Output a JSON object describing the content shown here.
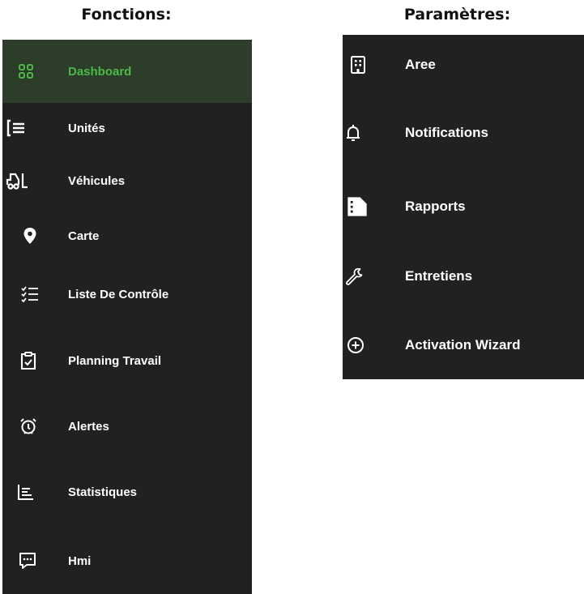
{
  "functions": {
    "heading": "Fonctions:",
    "items": [
      {
        "label": "Dashboard",
        "icon": "dashboard-grid-icon",
        "active": true
      },
      {
        "label": "Unités",
        "icon": "list-bracket-icon"
      },
      {
        "label": "Véhicules",
        "icon": "forklift-icon"
      },
      {
        "label": "Carte",
        "icon": "map-pin-icon"
      },
      {
        "label": "Liste De Contrôle",
        "icon": "checklist-icon"
      },
      {
        "label": "Planning Travail",
        "icon": "clipboard-check-icon"
      },
      {
        "label": "Alertes",
        "icon": "alarm-clock-icon"
      },
      {
        "label": "Statistiques",
        "icon": "bar-chart-icon"
      },
      {
        "label": "Hmi",
        "icon": "chat-bubble-icon"
      }
    ]
  },
  "settings": {
    "heading": "Paramètres:",
    "items": [
      {
        "label": "Aree",
        "icon": "building-icon"
      },
      {
        "label": "Notifications",
        "icon": "bell-icon"
      },
      {
        "label": "Rapports",
        "icon": "report-document-icon"
      },
      {
        "label": "Entretiens",
        "icon": "wrench-icon"
      },
      {
        "label": "Activation Wizard",
        "icon": "plus-circle-icon"
      }
    ]
  },
  "colors": {
    "panel_background": "#212121",
    "active_background": "#2c3e2a",
    "active_accent": "#4cb84a",
    "text": "#ffffff"
  }
}
